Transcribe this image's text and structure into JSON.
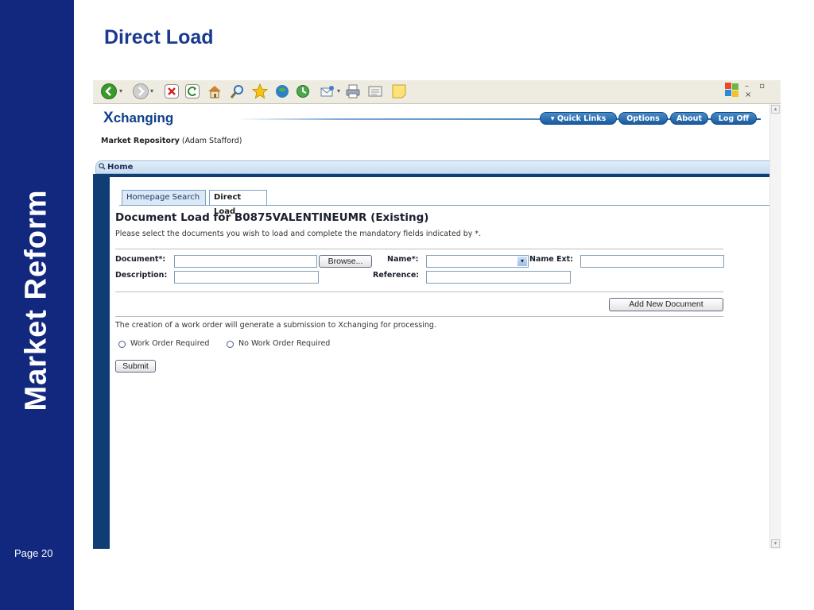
{
  "slide": {
    "title": "Direct Load",
    "side_title": "Market Reform",
    "page_label": "Page 20"
  },
  "browser": {
    "toolbar_icons": [
      "back-icon",
      "forward-icon",
      "stop-icon",
      "refresh-icon",
      "home-icon",
      "search-icon",
      "favorites-icon",
      "media-icon",
      "history-icon",
      "mail-icon",
      "print-icon",
      "edit-icon",
      "messenger-icon"
    ],
    "window_controls": "– ▫ ×"
  },
  "header": {
    "logo_prefix": "X",
    "logo_rest": "changing",
    "nav": {
      "quick_links": "▾ Quick Links",
      "options": "Options",
      "about": "About",
      "logoff": "Log Off"
    },
    "repo_bold": "Market Repository",
    "repo_user": " (Adam Stafford)"
  },
  "home_bar": {
    "label": "Home"
  },
  "tabs": [
    {
      "label": "Homepage Search",
      "active": false
    },
    {
      "label": "Direct Load",
      "active": true
    }
  ],
  "form": {
    "title": "Document Load for B0875VALENTINEUMR (Existing)",
    "instructions": "Please select the documents you wish to load and complete the mandatory fields indicated by *.",
    "document_label": "Document*:",
    "document_value": "",
    "browse_label": "Browse...",
    "name_label": "Name*:",
    "name_value": "",
    "name_ext_label": "Name Ext:",
    "name_ext_value": "",
    "description_label": "Description:",
    "description_value": "",
    "reference_label": "Reference:",
    "reference_value": "",
    "add_button": "Add New Document",
    "note": "The creation of a work order will generate a submission to Xchanging for processing.",
    "radio_required": "Work Order Required",
    "radio_not_required": "No Work Order Required",
    "submit": "Submit"
  },
  "colors": {
    "side_bar": "#11287e",
    "slide_title": "#1a3a8f",
    "nav_dark": "#0f3d74",
    "pill": "#185b9e"
  }
}
